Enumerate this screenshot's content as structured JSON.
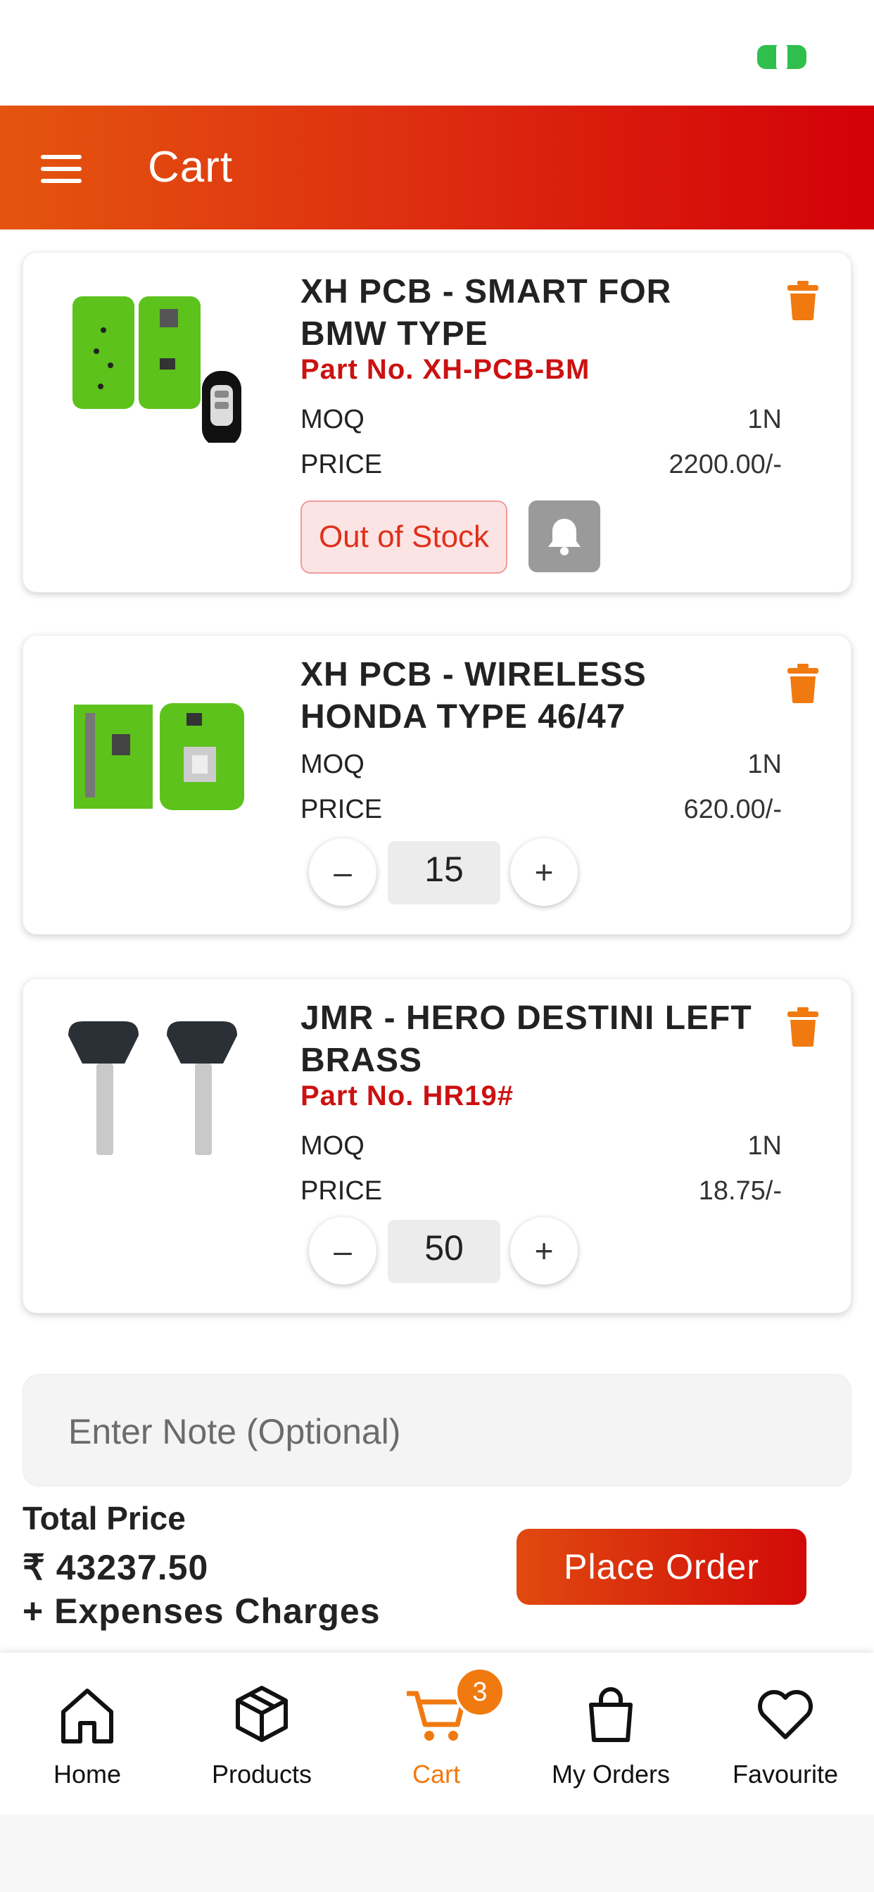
{
  "header": {
    "title": "Cart"
  },
  "cart_items": [
    {
      "name": "XH PCB - SMART FOR BMW TYPE",
      "part_no": "Part No. XH-PCB-BM",
      "moq_label": "MOQ",
      "moq": "1N",
      "price_label": "PRICE",
      "price": "2200.00/-",
      "status": "Out of Stock",
      "image": "green-pcb-with-bmw-key"
    },
    {
      "name": "XH PCB - WIRELESS HONDA TYPE 46/47",
      "moq_label": "MOQ",
      "moq": "1N",
      "price_label": "PRICE",
      "price": "620.00/-",
      "quantity": "15",
      "image": "green-pcb-honda"
    },
    {
      "name": "JMR - HERO DESTINI LEFT BRASS",
      "part_no": "Part No. HR19#",
      "moq_label": "MOQ",
      "moq": "1N",
      "price_label": "PRICE",
      "price": "18.75/-",
      "quantity": "50",
      "image": "two-keys"
    }
  ],
  "stepper": {
    "minus": "–",
    "plus": "+"
  },
  "note": {
    "placeholder": "Enter Note (Optional)"
  },
  "total": {
    "label": "Total Price",
    "value": "₹ 43237.50",
    "expenses": "+ Expenses Charges"
  },
  "place_order_label": "Place Order",
  "tabbar": {
    "tabs": [
      {
        "label": "Home",
        "icon": "home-icon"
      },
      {
        "label": "Products",
        "icon": "box-icon"
      },
      {
        "label": "Cart",
        "icon": "cart-icon",
        "badge": "3",
        "active": true
      },
      {
        "label": "My Orders",
        "icon": "bag-icon"
      },
      {
        "label": "Favourite",
        "icon": "heart-icon"
      }
    ]
  },
  "colors": {
    "accent": "#f07a10",
    "brand_red": "#d30008",
    "part_red": "#cc1111"
  }
}
